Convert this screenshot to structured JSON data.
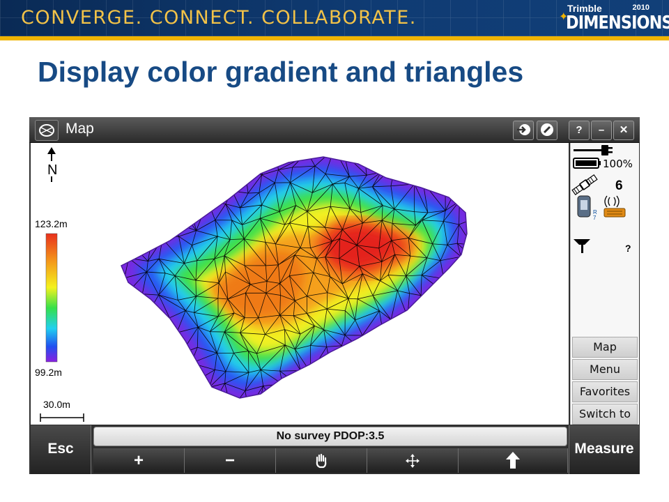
{
  "banner": {
    "tagline": "CONVERGE. CONNECT. COLLABORATE.",
    "brand_top": "Trimble",
    "brand_year": "2010",
    "brand_main": "DIMENSIONS"
  },
  "slide": {
    "title": "Display color gradient and triangles"
  },
  "window": {
    "title": "Map",
    "buttons": {
      "help": "?",
      "minimize": "–",
      "close": "✕"
    }
  },
  "map": {
    "north": "N",
    "legend_max": "123.2m",
    "legend_min": "99.2m",
    "scale": "30.0m",
    "gradient_colors": [
      "#e8301c",
      "#f49a1a",
      "#f4f21e",
      "#35e04a",
      "#20d0f0",
      "#2050f0",
      "#8a20e0"
    ]
  },
  "status": {
    "battery": "100%",
    "satellites": "6",
    "unknown": "?"
  },
  "softkeys": [
    "Map",
    "Menu",
    "Favorites",
    "Switch to"
  ],
  "bottom": {
    "esc": "Esc",
    "status_line": "No survey  PDOP:3.5",
    "zoom_in": "+",
    "zoom_out": "−",
    "measure": "Measure"
  }
}
